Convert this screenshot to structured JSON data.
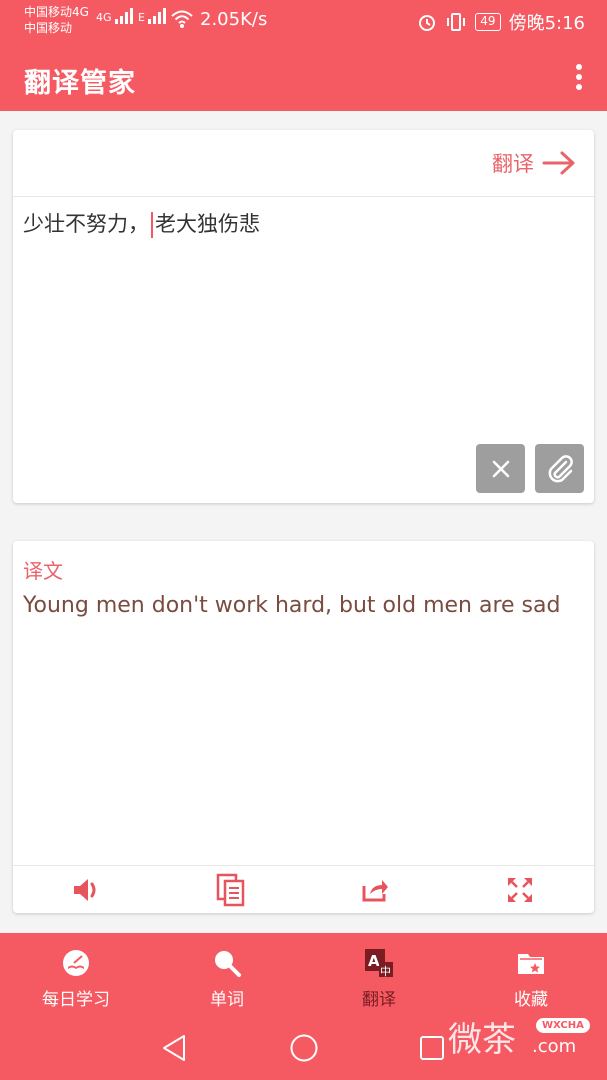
{
  "status_bar": {
    "carrier_1": "中国移动4G",
    "carrier_2": "中国移动",
    "sig1": "4G",
    "sig2": "E",
    "speed": "2.05K/s",
    "battery": "49",
    "time": "傍晚5:16"
  },
  "app_bar": {
    "title": "翻译管家",
    "menu_icon": "more-vert-icon"
  },
  "input_card": {
    "translate_label": "翻译",
    "text_before_caret": "少壮不努力，",
    "text_after_caret": "老大独伤悲"
  },
  "output_card": {
    "label": "译文",
    "text": "Young men don't work hard, but old men are sad"
  },
  "bottom_nav": {
    "items": [
      {
        "label": "每日学习",
        "icon": "daily-study-icon"
      },
      {
        "label": "单词",
        "icon": "search-icon"
      },
      {
        "label": "翻译",
        "icon": "translate-icon",
        "active": true
      },
      {
        "label": "收藏",
        "icon": "favorites-folder-icon"
      }
    ]
  },
  "watermark": {
    "text": "微茶",
    "badge": "WXCHA",
    "domain": ".com"
  },
  "colors": {
    "brand": "#f55a63",
    "accent_text": "#e8646a",
    "active_nav": "#7a1c22",
    "gray_button": "#9e9e9e"
  }
}
